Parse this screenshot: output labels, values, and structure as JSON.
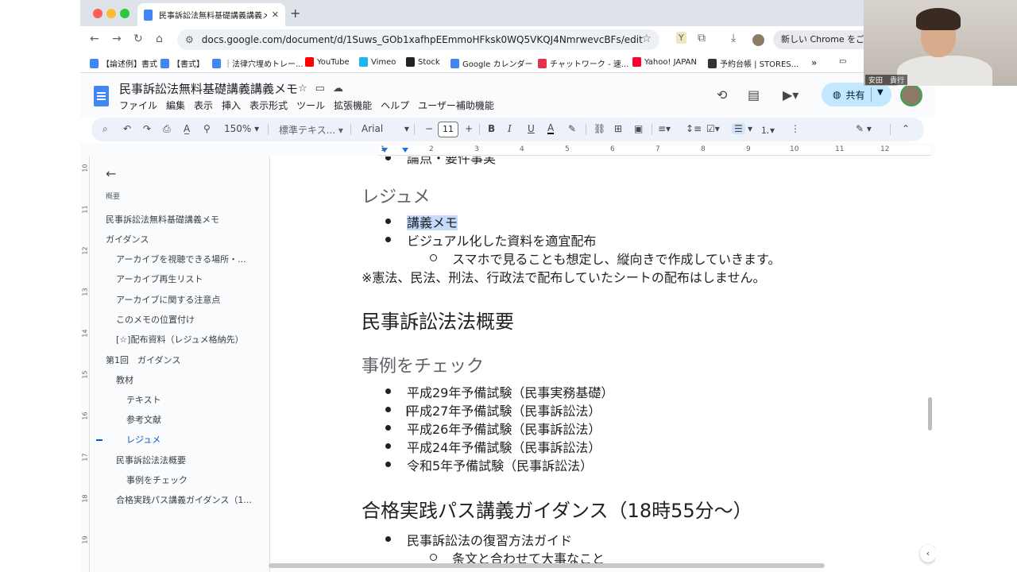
{
  "browser": {
    "tab_title": "民事訴訟法無料基礎講義講義メモ",
    "url": "docs.google.com/document/d/1Suws_GOb1xafhpEEmmoHFksk0WQ5VKQJ4NmrwevcBFs/edit",
    "chrome_button": "新しい Chrome をご利用"
  },
  "bookmarks": [
    {
      "label": "【論述例】書式",
      "icon_color": "#4285f4"
    },
    {
      "label": "【書式】",
      "icon_color": "#4285f4"
    },
    {
      "label": "｜法律穴埋めトレー...",
      "icon_color": "#4285f4"
    },
    {
      "label": "YouTube",
      "icon_color": "#ff0000"
    },
    {
      "label": "Vimeo",
      "icon_color": "#1ab7ea"
    },
    {
      "label": "Stock",
      "icon_color": "#222222"
    },
    {
      "label": "Google カレンダー",
      "icon_color": "#4285f4"
    },
    {
      "label": "チャットワーク - 速...",
      "icon_color": "#e2344a"
    },
    {
      "label": "Yahoo! JAPAN",
      "icon_color": "#ff0033"
    },
    {
      "label": "予約台帳 | STORES...",
      "icon_color": "#333333"
    }
  ],
  "docs": {
    "title": "民事訴訟法無料基礎講義講義メモ",
    "menus": [
      "ファイル",
      "編集",
      "表示",
      "挿入",
      "表示形式",
      "ツール",
      "拡張機能",
      "ヘルプ",
      "ユーザー補助機能"
    ],
    "share": "共有",
    "zoom": "150%",
    "style": "標準テキス...",
    "font": "Arial",
    "font_size": "11"
  },
  "outline": {
    "label": "概要",
    "items": [
      {
        "text": "民事訴訟法無料基礎講義メモ",
        "level": 0
      },
      {
        "text": "ガイダンス",
        "level": 0
      },
      {
        "text": "アーカイブを視聴できる場所・...",
        "level": 1
      },
      {
        "text": "アーカイブ再生リスト",
        "level": 1
      },
      {
        "text": "アーカイブに関する注意点",
        "level": 1
      },
      {
        "text": "このメモの位置付け",
        "level": 1
      },
      {
        "text": "[☆]配布資料（レジュメ格納先）",
        "level": 1
      },
      {
        "text": "第1回　ガイダンス",
        "level": 0
      },
      {
        "text": "教材",
        "level": 1
      },
      {
        "text": "テキスト",
        "level": 2
      },
      {
        "text": "参考文献",
        "level": 2
      },
      {
        "text": "レジュメ",
        "level": 2
      },
      {
        "text": "民事訴訟法法概要",
        "level": 1
      },
      {
        "text": "事例をチェック",
        "level": 2
      },
      {
        "text": "合格実践パス講義ガイダンス（1...",
        "level": 1
      }
    ]
  },
  "content": {
    "cut_line": "論点・要件事実",
    "resume_heading": "レジュメ",
    "resume_items": [
      "講義メモ",
      "ビジュアル化した資料を適宜配布"
    ],
    "resume_sub": "スマホで見ることも想定し、縦向きで作成していきます。",
    "note": "※憲法、民法、刑法、行政法で配布していたシートの配布はしません。",
    "overview_heading": "民事訴訟法法概要",
    "cases_heading": "事例をチェック",
    "cases": [
      "平成29年予備試験（民事実務基礎）",
      "平成27年予備試験（民事訴訟法）",
      "平成26年予備試験（民事訴訟法）",
      "平成24年予備試験（民事訴訟法）",
      "令和5年予備試験（民事訴訟法）"
    ],
    "pass_heading": "合格実践パス講義ガイダンス（18時55分〜）",
    "pass_items": [
      "民事訴訟法の復習方法ガイド"
    ],
    "pass_sub": "条文と合わせて大事なこと"
  },
  "webcam": {
    "name": "安田　貴行"
  }
}
